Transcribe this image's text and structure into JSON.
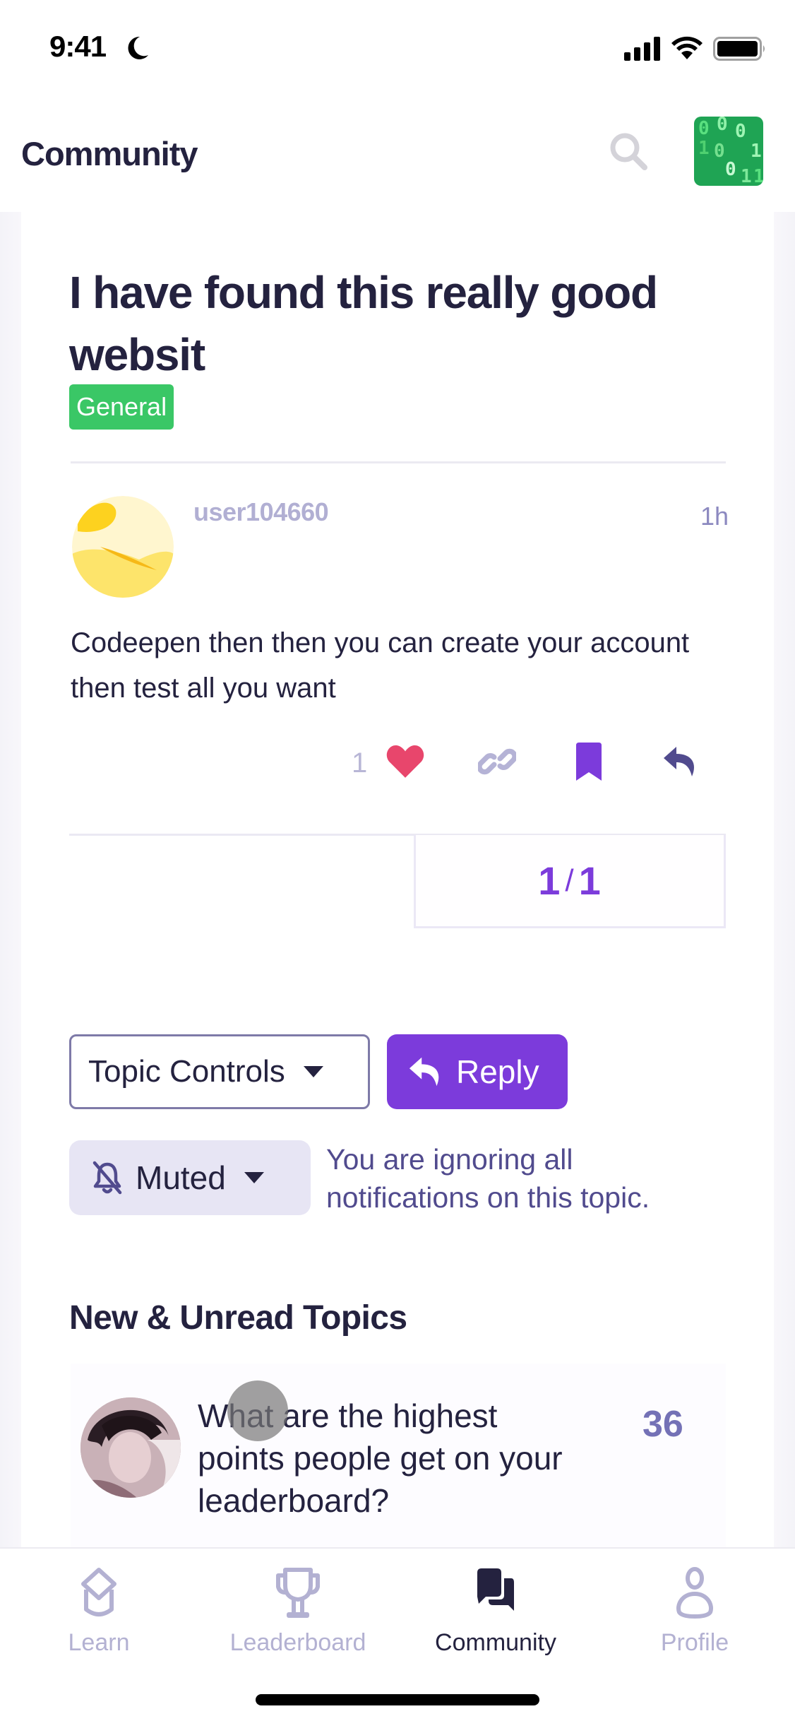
{
  "status_bar": {
    "time": "9:41",
    "icons": [
      "moon-icon",
      "signal-icon",
      "wifi-icon",
      "battery-icon"
    ]
  },
  "header": {
    "title": "Community",
    "search_icon": "search-icon",
    "avatar_glyphs": [
      "0",
      "0",
      "0",
      "1",
      "0",
      "1",
      "0",
      "1",
      "1"
    ]
  },
  "topic": {
    "title": "I have found this really good websit",
    "category": "General",
    "category_color": "#3ac766"
  },
  "post": {
    "username": "user104660",
    "time": "1h",
    "body": "Codeepen then then you can create your account then test all you want",
    "like_count": "1",
    "actions": [
      "heart-icon",
      "link-icon",
      "bookmark-icon",
      "reply-icon"
    ]
  },
  "pager": {
    "current": "1",
    "separator": "/",
    "total": "1"
  },
  "controls": {
    "topic_controls_label": "Topic Controls",
    "reply_label": "Reply",
    "notification_level": "Muted",
    "notification_note": "You are ignoring all notifications on this topic."
  },
  "new_unread": {
    "title": "New & Unread Topics",
    "items": [
      {
        "title": "What are the highest points people get on your leaderboard?",
        "count": "36"
      }
    ]
  },
  "tab_bar": {
    "tabs": [
      {
        "label": "Learn",
        "icon": "graduation-cap-icon",
        "active": false
      },
      {
        "label": "Leaderboard",
        "icon": "trophy-icon",
        "active": false
      },
      {
        "label": "Community",
        "icon": "chat-bubbles-icon",
        "active": true
      },
      {
        "label": "Profile",
        "icon": "person-icon",
        "active": false
      }
    ]
  },
  "colors": {
    "accent": "#7c3bdb",
    "text_dark": "#24223f",
    "muted_text": "#b1afd3",
    "heart": "#e8466c",
    "note_text": "#514b8e"
  }
}
